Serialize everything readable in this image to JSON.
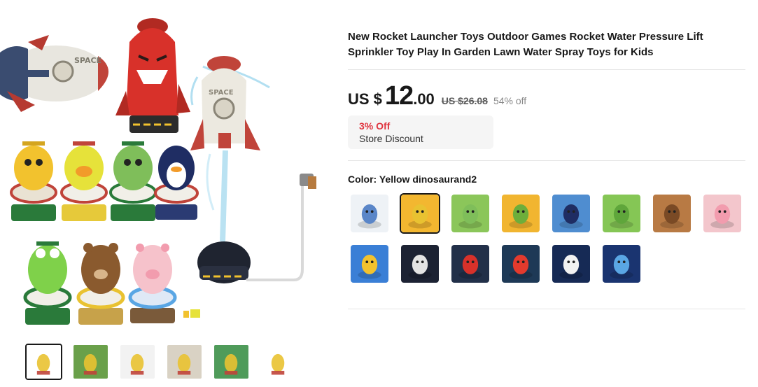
{
  "product": {
    "title": "New Rocket Launcher Toys Outdoor Games Rocket Water Pressure Lift Sprinkler Toy Play In Garden Lawn Water Spray Toys for Kids"
  },
  "price": {
    "currency": "US $",
    "integer": "12",
    "decimal": ".00",
    "original": "US $26.08",
    "off": "54% off"
  },
  "discount": {
    "percent": "3% Off",
    "label": "Store Discount"
  },
  "color": {
    "label": "Color: Yellow dinosaurand2"
  },
  "main_image_text": {
    "space_left": "SPACE",
    "space_right": "SPACE"
  },
  "swatches": [
    {
      "name": "accessories",
      "bg": "#eef2f6",
      "accent": "#5a86c8"
    },
    {
      "name": "yellow-dinosaur",
      "bg": "#f3b730",
      "accent": "#e9c231",
      "selected": true
    },
    {
      "name": "green-dinosaur",
      "bg": "#8bc65a",
      "accent": "#7fbe5a"
    },
    {
      "name": "green-crocodile",
      "bg": "#f1b530",
      "accent": "#6dae3b"
    },
    {
      "name": "penguin",
      "bg": "#4f8dd0",
      "accent": "#1f2d63"
    },
    {
      "name": "frog",
      "bg": "#85c655",
      "accent": "#5fa63b"
    },
    {
      "name": "bear",
      "bg": "#b87a44",
      "accent": "#7a4a25"
    },
    {
      "name": "pig",
      "bg": "#f3c6cc",
      "accent": "#f29cae"
    },
    {
      "name": "yellow-rocket",
      "bg": "#3a7fd6",
      "accent": "#f2c22e"
    },
    {
      "name": "white-rocket",
      "bg": "#1c2233",
      "accent": "#e3e3e3"
    },
    {
      "name": "red-rocket",
      "bg": "#223049",
      "accent": "#d8312a"
    },
    {
      "name": "red-rocket-2",
      "bg": "#1e3956",
      "accent": "#e33a2d"
    },
    {
      "name": "white-rocket-2",
      "bg": "#162a55",
      "accent": "#f2f2f2"
    },
    {
      "name": "blue-rocket",
      "bg": "#1a3470",
      "accent": "#5aa6e4"
    }
  ],
  "thumbnails": [
    {
      "name": "thumb-all",
      "bg": "#ffffff",
      "active": true
    },
    {
      "name": "thumb-garden-1",
      "bg": "#6aa04a"
    },
    {
      "name": "thumb-diagram",
      "bg": "#f2f2f2"
    },
    {
      "name": "thumb-kids",
      "bg": "#d9d2c4"
    },
    {
      "name": "thumb-garden-2",
      "bg": "#4f9b5a"
    },
    {
      "name": "thumb-duck",
      "bg": "#ffffff"
    }
  ]
}
